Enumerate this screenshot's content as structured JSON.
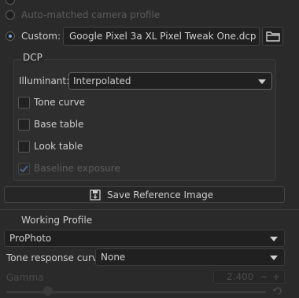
{
  "camera_profile": {
    "auto_matched_label": "Auto-matched camera profile",
    "custom_label": "Custom:",
    "custom_file": "Google Pixel 3a XL Pixel Tweak One.dcp"
  },
  "dcp": {
    "title": "DCP",
    "illuminant_label": "Illuminant:",
    "illuminant_value": "Interpolated",
    "tone_curve": "Tone curve",
    "base_table": "Base table",
    "look_table": "Look table",
    "baseline_exposure": "Baseline exposure"
  },
  "save_reference_label": "Save Reference Image",
  "working_profile": {
    "title": "Working Profile",
    "value": "ProPhoto",
    "tone_response_label": "Tone response curve:",
    "tone_response_value": "None",
    "gamma_label": "Gamma",
    "gamma_value": "2.400"
  },
  "colors": {
    "background": "#2a2a2a",
    "accent": "#86a8d6"
  }
}
